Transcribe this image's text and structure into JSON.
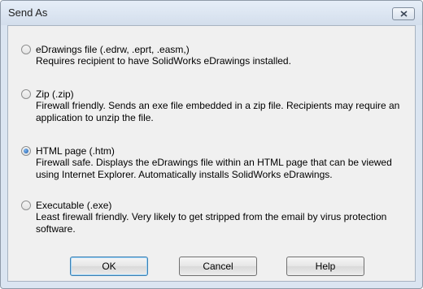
{
  "window": {
    "title": "Send As"
  },
  "options": [
    {
      "label": "eDrawings file (.edrw, .eprt, .easm,)",
      "description": "Requires recipient to have SolidWorks eDrawings installed.",
      "selected": false
    },
    {
      "label": "Zip (.zip)",
      "description": "Firewall friendly. Sends an exe file embedded in a zip file. Recipients may require an application to unzip the file.",
      "selected": false
    },
    {
      "label": "HTML page (.htm)",
      "description": "Firewall safe. Displays the eDrawings file within an HTML page that can be viewed using Internet Explorer. Automatically installs SolidWorks eDrawings.",
      "selected": true
    },
    {
      "label": "Executable (.exe)",
      "description": "Least firewall friendly. Very likely to get stripped from the email by virus protection software.",
      "selected": false
    }
  ],
  "buttons": {
    "ok": "OK",
    "cancel": "Cancel",
    "help": "Help"
  }
}
